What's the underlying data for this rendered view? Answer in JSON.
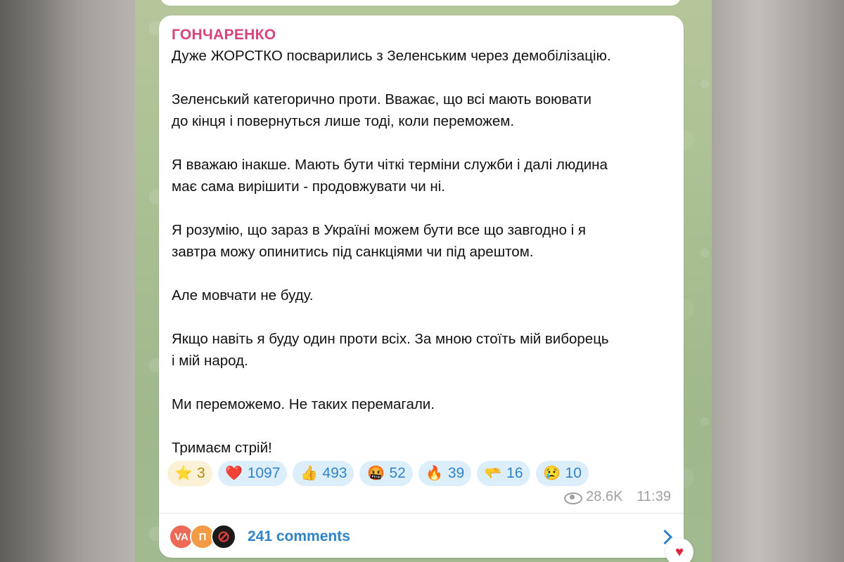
{
  "message": {
    "sender": "ГОНЧАРЕНКО",
    "paragraphs": [
      "Дуже ЖОРСТКО посварились з Зеленським через демобілізацію.",
      "Зеленський категорично проти. Вважає, що всі мають воювати\nдо кінця і повернуться лише тоді, коли переможем.",
      "Я вважаю інакше. Мають бути чіткі терміни служби і далі людина\nмає сама вирішити - продовжувати чи ні.",
      "Я розумію, що зараз в Україні можем бути все що завгодно і я\nзавтра можу опинитись під санкціями чи під арештом.",
      "Але мовчати не буду.",
      "Якщо навіть я буду один проти всіх. За мною стоїть мій виборець\nі мій народ.",
      "Ми переможемо. Не таких перемагали.",
      "Тримаєм стрій!"
    ],
    "reactions": [
      {
        "icon": "star-icon",
        "emoji": "⭐",
        "count": "3"
      },
      {
        "icon": "heart-icon",
        "emoji": "❤️",
        "count": "1097"
      },
      {
        "icon": "thumbs-up-icon",
        "emoji": "👍",
        "count": "493"
      },
      {
        "icon": "angry-face-icon",
        "emoji": "🤬",
        "count": "52"
      },
      {
        "icon": "fire-icon",
        "emoji": "🔥",
        "count": "39"
      },
      {
        "icon": "pointing-hand-icon",
        "emoji": "🫳",
        "count": "16"
      },
      {
        "icon": "crying-face-icon",
        "emoji": "😢",
        "count": "10"
      }
    ],
    "views": "28.6K",
    "time": "11:39",
    "comments": {
      "label": "241 comments",
      "avatars": [
        "VA",
        "П",
        "⊘"
      ]
    }
  },
  "colors": {
    "sender": "#d7437d",
    "link": "#2f84c9",
    "reaction_bg": "#ddeefb",
    "paid_reaction_bg": "#fbf1d6"
  }
}
